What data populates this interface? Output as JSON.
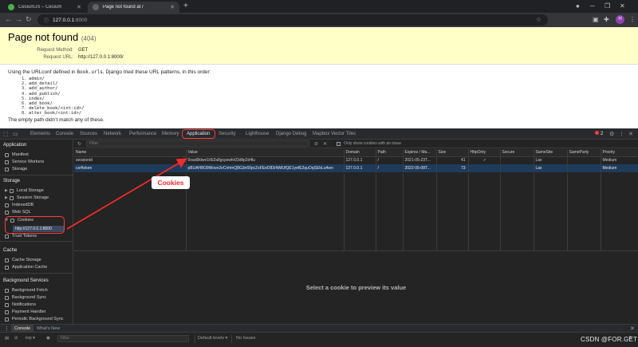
{
  "browser": {
    "tabs": [
      {
        "label": "CesiumJS – Cesium",
        "active": false
      },
      {
        "label": "Page not found at /",
        "active": true
      }
    ],
    "address": {
      "host": "127.0.0.1",
      "port": ":8000"
    }
  },
  "page": {
    "title": "Page not found",
    "code": "(404)",
    "request_method_label": "Request Method:",
    "request_method": "GET",
    "request_url_label": "Request URL:",
    "request_url": "http://127.0.0.1:8000/",
    "info_prefix": "Using the URLconf defined in ",
    "urlconf": "Book.urls",
    "info_suffix": ", Django tried these URL patterns, in this order:",
    "patterns": [
      {
        "n": "1.",
        "p": "admin/"
      },
      {
        "n": "2.",
        "p": "add_detail/"
      },
      {
        "n": "3.",
        "p": "add_author/"
      },
      {
        "n": "4.",
        "p": "add_publish/"
      },
      {
        "n": "5.",
        "p": "index/"
      },
      {
        "n": "6.",
        "p": "add_book/"
      },
      {
        "n": "7.",
        "p": "delete_book/<int:id>/"
      },
      {
        "n": "8.",
        "p": "alter_book/<int:id>/"
      }
    ],
    "no_match": "The empty path didn't match any of these."
  },
  "devtools": {
    "tabs": [
      "Elements",
      "Console",
      "Sources",
      "Network",
      "Performance",
      "Memory",
      "Application",
      "Security",
      "Lighthouse",
      "Django Debug",
      "Mapbox Vector Tiles"
    ],
    "active_tab": "Application",
    "issues_count": "2",
    "sidebar": {
      "application_header": "Application",
      "application_items": [
        "Manifest",
        "Service Workers",
        "Storage"
      ],
      "storage_header": "Storage",
      "storage_items": [
        "Local Storage",
        "Session Storage",
        "IndexedDB",
        "Web SQL",
        "Cookies"
      ],
      "cookie_host": "http://127.0.0.1:8000",
      "trust_tokens": "Trust Tokens",
      "cache_header": "Cache",
      "cache_items": [
        "Cache Storage",
        "Application Cache"
      ],
      "bg_header": "Background Services",
      "bg_items": [
        "Background Fetch",
        "Background Sync",
        "Notifications",
        "Payment Handler",
        "Periodic Background Sync"
      ]
    },
    "filter_placeholder": "Filter",
    "only_issue_label": "Only show cookies with an issue",
    "columns": [
      "Name",
      "Value",
      "Domain",
      "Path",
      "Expires / Ma...",
      "Size",
      "HttpOnly",
      "Secure",
      "SameSite",
      "SameParty",
      "Priority"
    ],
    "rows": [
      [
        "sessionid",
        "0oad9klwo1t6i2a8gcpswfo03dltp2d4lu",
        "127.0.0.1",
        "/",
        "2021-05-23T...",
        "41",
        "✓",
        "",
        "Lax",
        "",
        "Medium"
      ],
      [
        "csrftoken",
        "pBUAH8O9Wove2eCnhmQ8G3n60pcZsFEeD83rNMUfQE1yefE2quOqSEbLu4wn",
        "127.0.0.1",
        "/",
        "2022-05-08T...",
        "73",
        "",
        "",
        "Lax",
        "",
        "Medium"
      ]
    ],
    "preview_text": "Select a cookie to preview its value",
    "drawer_tabs": [
      "Console",
      "What's New"
    ],
    "console": {
      "context": "top",
      "filter_placeholder": "Filter",
      "levels": "Default levels ▾",
      "issues": "No Issues"
    }
  },
  "annotation": {
    "label": "Cookies",
    "color": "#ff2a2a"
  },
  "watermark": "CSDN @FOR.GET"
}
